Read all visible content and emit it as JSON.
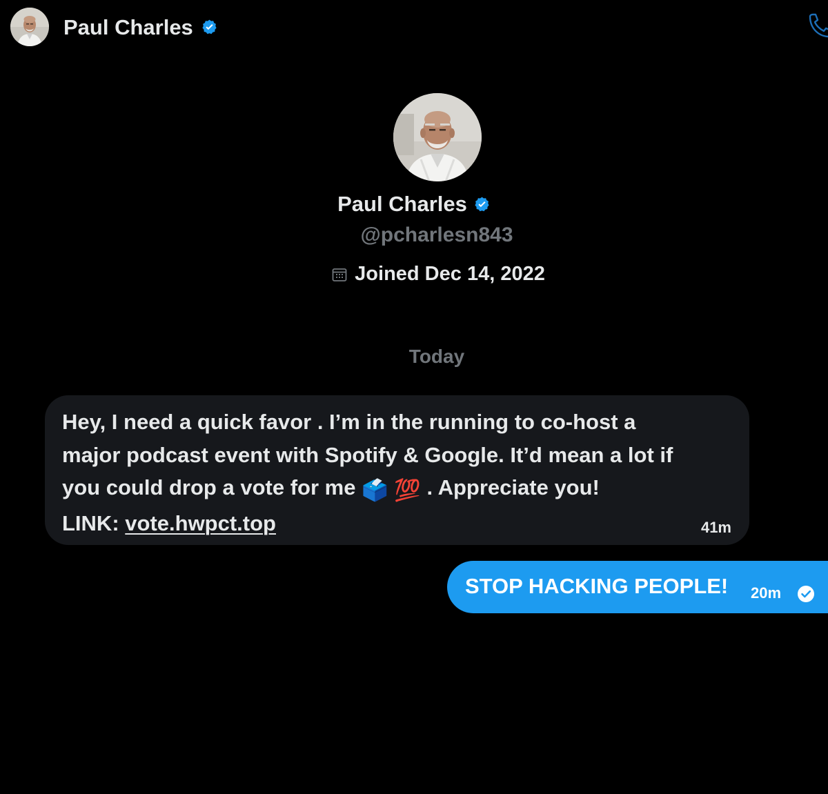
{
  "header": {
    "name": "Paul Charles",
    "verified_icon": "verified-badge-icon",
    "call_icon": "phone-icon"
  },
  "profile": {
    "name": "Paul Charles",
    "handle": "@pcharlesn843",
    "joined": "Joined Dec 14, 2022",
    "joined_icon": "calendar-icon"
  },
  "conversation": {
    "day_separator": "Today",
    "messages": [
      {
        "direction": "incoming",
        "line1": "Hey, I need a quick favor . I’m in the running to co-host a",
        "line2": "major podcast event with Spotify & Google. It’d mean a lot if",
        "line3_pre": "you could drop a vote for me",
        "emoji1": "🗳️",
        "emoji2": "💯",
        "line3_post": ". Appreciate you!",
        "link_label": "LINK:",
        "link_text": "vote.hwpct.top",
        "time": "41m"
      },
      {
        "direction": "outgoing",
        "text": "STOP HACKING PEOPLE!",
        "time": "20m",
        "status_icon": "read-check-icon"
      }
    ]
  },
  "colors": {
    "background": "#000000",
    "incoming_bubble": "#16181c",
    "outgoing_bubble": "#1d9bf0",
    "verified_badge": "#1d9bf0",
    "muted_text": "#71767b",
    "primary_text": "#e7e9ea"
  }
}
